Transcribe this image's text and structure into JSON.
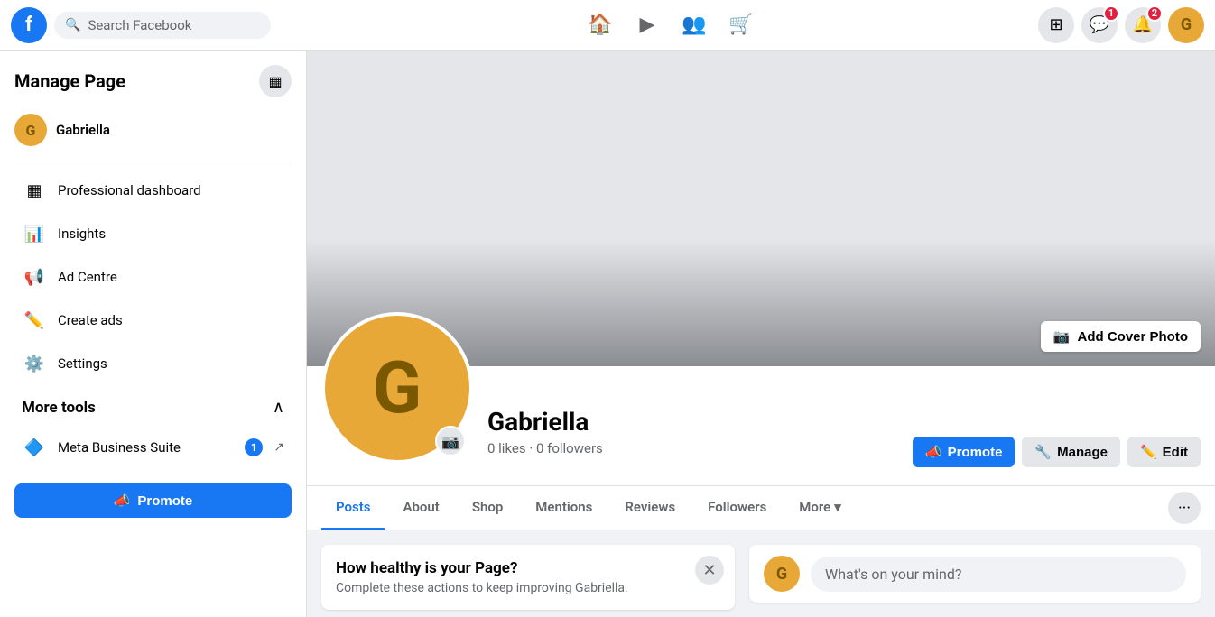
{
  "topNav": {
    "logoText": "f",
    "searchPlaceholder": "Search Facebook",
    "icons": {
      "home": "⌂",
      "video": "▶",
      "people": "👥",
      "marketplace": "🛒"
    },
    "messengerBadge": "1",
    "notificationBadge": "2",
    "gridIcon": "⊞",
    "userInitial": "G"
  },
  "sidebar": {
    "title": "Manage Page",
    "settingsIcon": "▦",
    "userInitial": "G",
    "userName": "Gabriella",
    "items": [
      {
        "id": "professional-dashboard",
        "icon": "▦",
        "label": "Professional dashboard"
      },
      {
        "id": "insights",
        "icon": "📊",
        "label": "Insights"
      },
      {
        "id": "ad-centre",
        "icon": "📢",
        "label": "Ad Centre"
      },
      {
        "id": "create-ads",
        "icon": "✏️",
        "label": "Create ads"
      },
      {
        "id": "settings",
        "icon": "⚙️",
        "label": "Settings"
      }
    ],
    "moreToolsSection": {
      "title": "More tools",
      "collapseIcon": "^",
      "subItems": [
        {
          "id": "meta-business-suite",
          "icon": "🔷",
          "label": "Meta Business Suite",
          "badge": "1",
          "externalIcon": "↗"
        }
      ]
    },
    "promoteButton": "Promote",
    "promoteMegaphoneIcon": "📣"
  },
  "profile": {
    "initial": "G",
    "name": "Gabriella",
    "stats": "0 likes · 0 followers",
    "addCoverPhoto": "Add Cover Photo",
    "cameraIcon": "📷",
    "actions": {
      "promote": "Promote",
      "manage": "Manage",
      "edit": "Edit"
    }
  },
  "tabs": {
    "items": [
      {
        "id": "posts",
        "label": "Posts",
        "active": true
      },
      {
        "id": "about",
        "label": "About",
        "active": false
      },
      {
        "id": "shop",
        "label": "Shop",
        "active": false
      },
      {
        "id": "mentions",
        "label": "Mentions",
        "active": false
      },
      {
        "id": "reviews",
        "label": "Reviews",
        "active": false
      },
      {
        "id": "followers",
        "label": "Followers",
        "active": false
      },
      {
        "id": "more",
        "label": "More",
        "active": false
      }
    ],
    "moreTabIcon": "▾",
    "ellipsisIcon": "···"
  },
  "content": {
    "healthCard": {
      "title": "How healthy is your Page?",
      "description": "Complete these actions to keep improving Gabriella."
    },
    "postBox": {
      "userInitial": "G",
      "placeholder": "What's on your mind?"
    }
  }
}
